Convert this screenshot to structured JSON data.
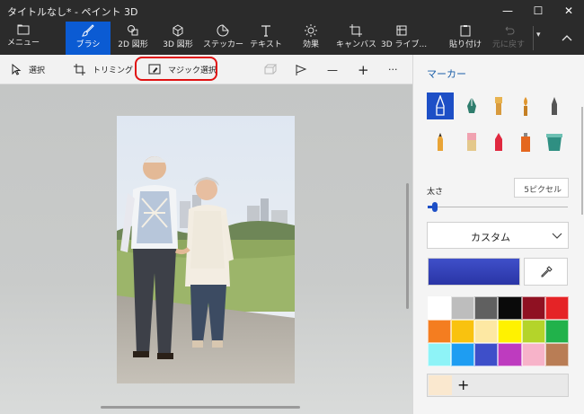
{
  "window": {
    "title": "タイトルなし* - ペイント 3D",
    "controls": {
      "minimize": "—",
      "maximize": "☐",
      "close": "✕"
    }
  },
  "ribbon": {
    "items": [
      {
        "label": "メニュー",
        "icon": "folder-icon"
      },
      {
        "label": "ブラシ",
        "icon": "brush-icon",
        "active": true
      },
      {
        "label": "2D 図形",
        "icon": "2d-shapes-icon"
      },
      {
        "label": "3D 図形",
        "icon": "3d-cube-icon"
      },
      {
        "label": "ステッカー",
        "icon": "sticker-icon"
      },
      {
        "label": "テキスト",
        "icon": "text-icon"
      },
      {
        "label": "効果",
        "icon": "effects-sun-icon"
      },
      {
        "label": "キャンバス",
        "icon": "canvas-icon"
      },
      {
        "label": "3D ライブ...",
        "icon": "3d-library-icon"
      },
      {
        "label": "貼り付け",
        "icon": "paste-icon"
      },
      {
        "label": "元に戻す",
        "icon": "undo-icon",
        "disabled": true
      }
    ],
    "overflow": "▾",
    "collapse": "︿"
  },
  "toolbar": {
    "select": "選択",
    "crop": "トリミング",
    "magic_select": "マジック選択",
    "minus": "—",
    "plus": "+",
    "more": "···"
  },
  "panel": {
    "title": "マーカー",
    "thickness_label": "太さ",
    "thickness_value": "5ピクセル",
    "thickness_fraction": 0.05,
    "finish": "カスタム",
    "add_color": "+",
    "selected_color": "#3a48c2",
    "custom_color": "#fae8cf",
    "palette": [
      "#ffffff",
      "#bdbdbd",
      "#606060",
      "#0a0a0a",
      "#8f1122",
      "#e52326",
      "#f47d20",
      "#f9c20f",
      "#fde8a3",
      "#fff200",
      "#b4d42a",
      "#21b24b",
      "#8ef3f7",
      "#1e9df2",
      "#3e4fc9",
      "#be3bbf",
      "#f7b3c9",
      "#b97d55"
    ]
  },
  "colors": {
    "ribbon_bg": "#2b2b2b",
    "accent": "#0b5bd3",
    "highlight_border": "#e01313"
  }
}
